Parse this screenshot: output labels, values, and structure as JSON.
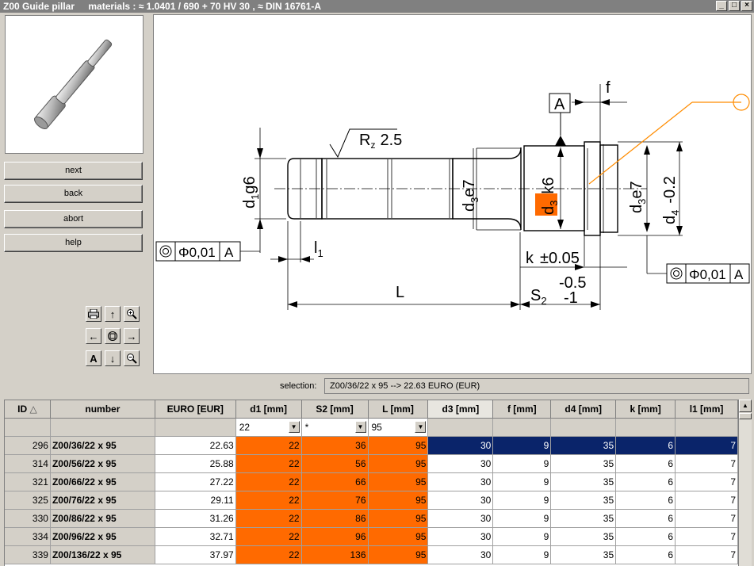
{
  "window": {
    "title": "Z00 Guide pillar",
    "materials": "materials : ≈ 1.0401 / 690 + 70 HV 30 , ≈ DIN 16761-A"
  },
  "nav": {
    "next": "next",
    "back": "back",
    "abort": "abort",
    "help": "help"
  },
  "drawing": {
    "rz": "R",
    "rz_sub": "z",
    "rz_val": "2.5",
    "tol_a": "A",
    "f": "f",
    "d1": "d",
    "d1_sub": "1",
    "d1_tol": "g6",
    "d3": "d",
    "d3_sub": "3",
    "d3_tol": "e7",
    "d3k6": "k6",
    "d4": "d",
    "d4_sub": "4",
    "d4_tol": "-0.2",
    "l1": "l",
    "l1_sub": "1",
    "L": "L",
    "k": "k",
    "k_tol": "±0.05",
    "s2": "S",
    "s2_sub": "2",
    "s2_tol1": "-0.5",
    "s2_tol2": "-1",
    "geo_left": "Φ0,01",
    "geo_left_ref": "A",
    "geo_right": "Φ0,01",
    "geo_right_ref": "A"
  },
  "selection": {
    "label": "selection:",
    "value": "Z00/36/22 x 95 --> 22.63 EURO (EUR)"
  },
  "table": {
    "headers": [
      "ID",
      "number",
      "EURO [EUR]",
      "d1 [mm]",
      "S2 [mm]",
      "L [mm]",
      "d3 [mm]",
      "f [mm]",
      "d4 [mm]",
      "k [mm]",
      "l1 [mm]"
    ],
    "sort_icon": "△",
    "filters": {
      "d1": "22",
      "s2": "*",
      "l": "95"
    },
    "rows": [
      [
        "296",
        "Z00/36/22 x 95",
        "22.63",
        "22",
        "36",
        "95",
        "30",
        "9",
        "35",
        "6",
        "7"
      ],
      [
        "314",
        "Z00/56/22 x 95",
        "25.88",
        "22",
        "56",
        "95",
        "30",
        "9",
        "35",
        "6",
        "7"
      ],
      [
        "321",
        "Z00/66/22 x 95",
        "27.22",
        "22",
        "66",
        "95",
        "30",
        "9",
        "35",
        "6",
        "7"
      ],
      [
        "325",
        "Z00/76/22 x 95",
        "29.11",
        "22",
        "76",
        "95",
        "30",
        "9",
        "35",
        "6",
        "7"
      ],
      [
        "330",
        "Z00/86/22 x 95",
        "31.26",
        "22",
        "86",
        "95",
        "30",
        "9",
        "35",
        "6",
        "7"
      ],
      [
        "334",
        "Z00/96/22 x 95",
        "32.71",
        "22",
        "96",
        "95",
        "30",
        "9",
        "35",
        "6",
        "7"
      ],
      [
        "339",
        "Z00/136/22 x 95",
        "37.97",
        "22",
        "136",
        "95",
        "30",
        "9",
        "35",
        "6",
        "7"
      ]
    ]
  },
  "colors": {
    "highlight": "#ff6a00",
    "selected_row": "#0a246a"
  }
}
